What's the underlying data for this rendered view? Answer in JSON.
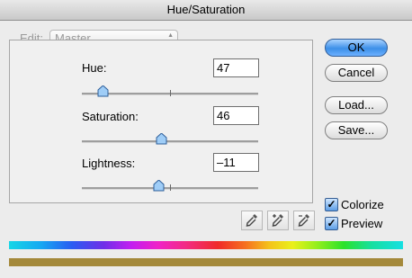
{
  "window": {
    "title": "Hue/Saturation"
  },
  "edit": {
    "label": "Edit:",
    "value": "Master"
  },
  "sliders": [
    {
      "label": "Hue:",
      "value": "47"
    },
    {
      "label": "Saturation:",
      "value": "46"
    },
    {
      "label": "Lightness:",
      "value": "–11"
    }
  ],
  "buttons": {
    "ok": "OK",
    "cancel": "Cancel",
    "load": "Load...",
    "save": "Save..."
  },
  "checkboxes": {
    "colorize": "Colorize",
    "preview": "Preview",
    "colorize_checked": true,
    "preview_checked": true
  },
  "tools": [
    "eyedropper-icon",
    "eyedropper-plus-icon",
    "eyedropper-minus-icon"
  ],
  "colors": {
    "accent": "#3c8fe8",
    "result_bar": "#a4893b"
  }
}
